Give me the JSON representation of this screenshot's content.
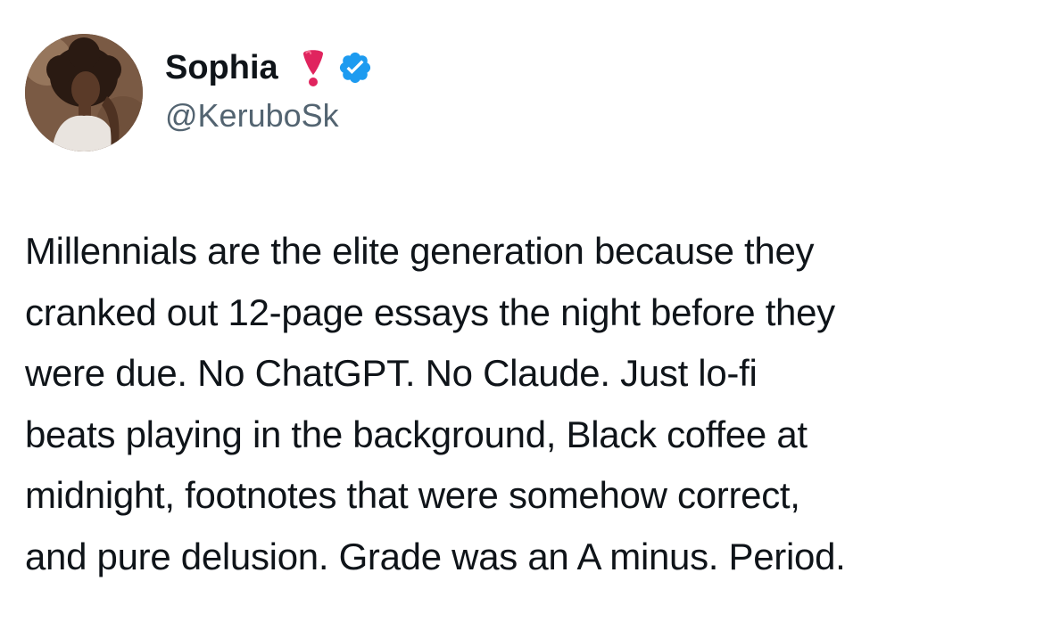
{
  "author": {
    "display_name": "Sophia",
    "handle": "@KeruboSk",
    "name_emoji_icon": "heavy-exclamation-mark-icon",
    "verified_icon": "verified-badge-icon",
    "verified_color": "#1d9bf0",
    "emoji_color": "#e0245e"
  },
  "tweet": {
    "text": "Millennials are the elite generation because they\ncranked out 12-page essays the night before they\nwere due. No ChatGPT. No Claude. Just lo-fi\nbeats playing in the background, Black coffee at\nmidnight, footnotes that were somehow correct,\nand pure delusion. Grade was an A minus. Period."
  }
}
